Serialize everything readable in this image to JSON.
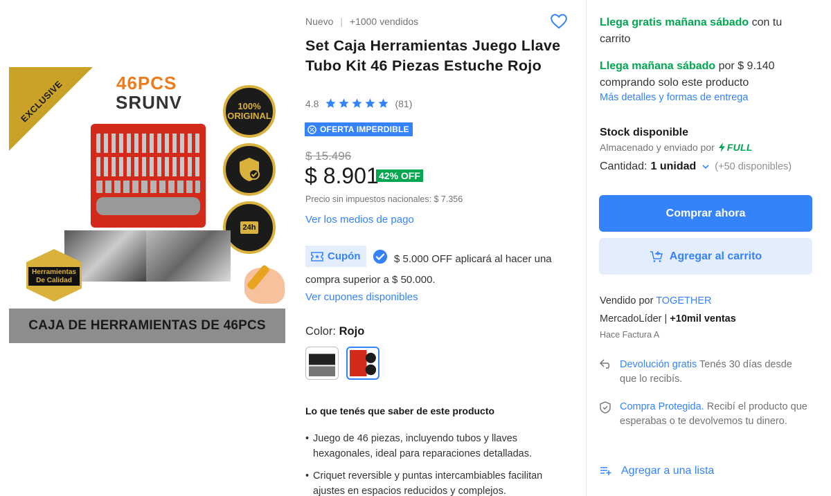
{
  "gallery": {
    "ribbon": "EXCLUSIVE",
    "pieces": "46PCS",
    "brand": "SRUNV",
    "badge_original": "100% ORIGINAL",
    "badge_delivery": "24h",
    "quality": "Herramientas De Calidad",
    "banner": "CAJA DE HERRAMIENTAS DE 46PCS"
  },
  "product": {
    "condition": "Nuevo",
    "separator": "|",
    "sold": "+1000 vendidos",
    "title": "Set Caja Herramientas Juego Llave Tubo Kit 46 Piezas Estuche Rojo",
    "rating": "4.8",
    "stars": 5,
    "reviews": "(81)",
    "offer_badge": "OFERTA IMPERDIBLE",
    "old_price": "$ 15.496",
    "price": "$ 8.901",
    "discount": "42% OFF",
    "tax_note": "Precio sin impuestos nacionales: $ 7.356",
    "payment_link": "Ver los medios de pago",
    "coupon_label": "Cupón",
    "coupon_text": "$ 5.000 OFF aplicará al hacer una compra superior a $ 50.000.",
    "coupons_link": "Ver cupones disponibles",
    "color_label": "Color:",
    "color_value": "Rojo",
    "know_title": "Lo que tenés que saber de este producto",
    "bullets": [
      "Juego de 46 piezas, incluyendo tubos y llaves hexagonales, ideal para reparaciones detalladas.",
      "Criquet reversible y puntas intercambiables facilitan ajustes en espacios reducidos y complejos."
    ]
  },
  "shipping": {
    "free_tomorrow": "Llega gratis mañana sábado",
    "free_tomorrow_suffix": "con tu carrito",
    "tomorrow": "Llega mañana sábado",
    "tomorrow_suffix": "por $ 9.140 comprando solo este producto",
    "details_link": "Más detalles y formas de entrega"
  },
  "stock": {
    "title": "Stock disponible",
    "stored_by": "Almacenado y enviado por",
    "full": "FULL",
    "qty_label": "Cantidad:",
    "qty_value": "1 unidad",
    "available": "(+50 disponibles)"
  },
  "actions": {
    "buy": "Comprar ahora",
    "cart": "Agregar al carrito",
    "add_list": "Agregar a una lista"
  },
  "seller": {
    "sold_by": "Vendido por",
    "name": "TOGETHER",
    "leader": "MercadoLíder |",
    "sales": "+10mil ventas",
    "invoice": "Hace Factura A"
  },
  "benefits": {
    "return_link": "Devolución gratis",
    "return_text": "Tenés 30 días desde que lo recibís.",
    "protect_link": "Compra Protegida.",
    "protect_text": "Recibí el producto que esperabas o te devolvemos tu dinero."
  },
  "colors": {
    "accent": "#3483fa",
    "green": "#00a650",
    "light_blue": "#e3edfb"
  }
}
